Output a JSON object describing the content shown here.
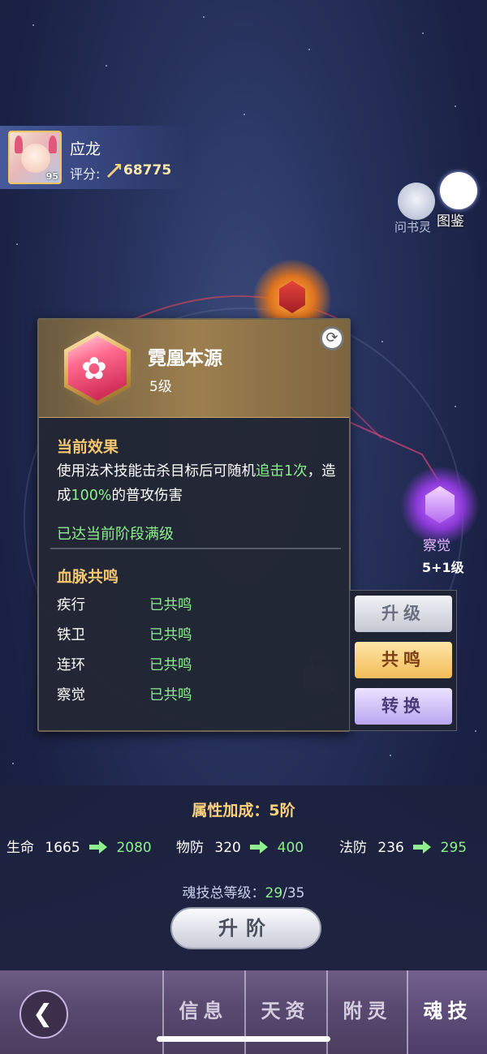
{
  "player": {
    "name": "应龙",
    "level": "95",
    "score_label": "评分:",
    "score": "68775"
  },
  "top_icons": {
    "helper_label": "问书灵",
    "codex_label": "图鉴"
  },
  "orb_right": {
    "name": "察觉",
    "level": "5+1级"
  },
  "skill_popup": {
    "name": "霓凰本源",
    "level": "5级",
    "current_effect_title": "当前效果",
    "effect_part1": "使用法术技能击杀目标后可随机",
    "effect_hl1": "追击1次",
    "effect_part2": "，造成",
    "effect_hl2": "100%",
    "effect_part3": "的普攻伤害",
    "maxed_text": "已达当前阶段满级",
    "resonance_title": "血脉共鸣",
    "resonances": [
      {
        "name": "疾行",
        "status": "已共鸣"
      },
      {
        "name": "铁卫",
        "status": "已共鸣"
      },
      {
        "name": "连环",
        "status": "已共鸣"
      },
      {
        "name": "察觉",
        "status": "已共鸣"
      }
    ]
  },
  "side_buttons": {
    "upgrade": "升级",
    "resonate": "共鸣",
    "convert": "转换"
  },
  "stats": {
    "title": "属性加成：5阶",
    "items": [
      {
        "name": "生命",
        "old": "1665",
        "new": "2080"
      },
      {
        "name": "物防",
        "old": "320",
        "new": "400"
      },
      {
        "name": "法防",
        "old": "236",
        "new": "295"
      }
    ],
    "total_label": "魂技总等级：",
    "total_current": "29",
    "total_max": "/35",
    "advance_button": "升阶"
  },
  "nav": {
    "tabs": [
      "信息",
      "天资",
      "附灵",
      "魂技"
    ],
    "active": "魂技"
  },
  "colors": {
    "highlight_green": "#8ef08e",
    "gold_title": "#f5c870"
  }
}
